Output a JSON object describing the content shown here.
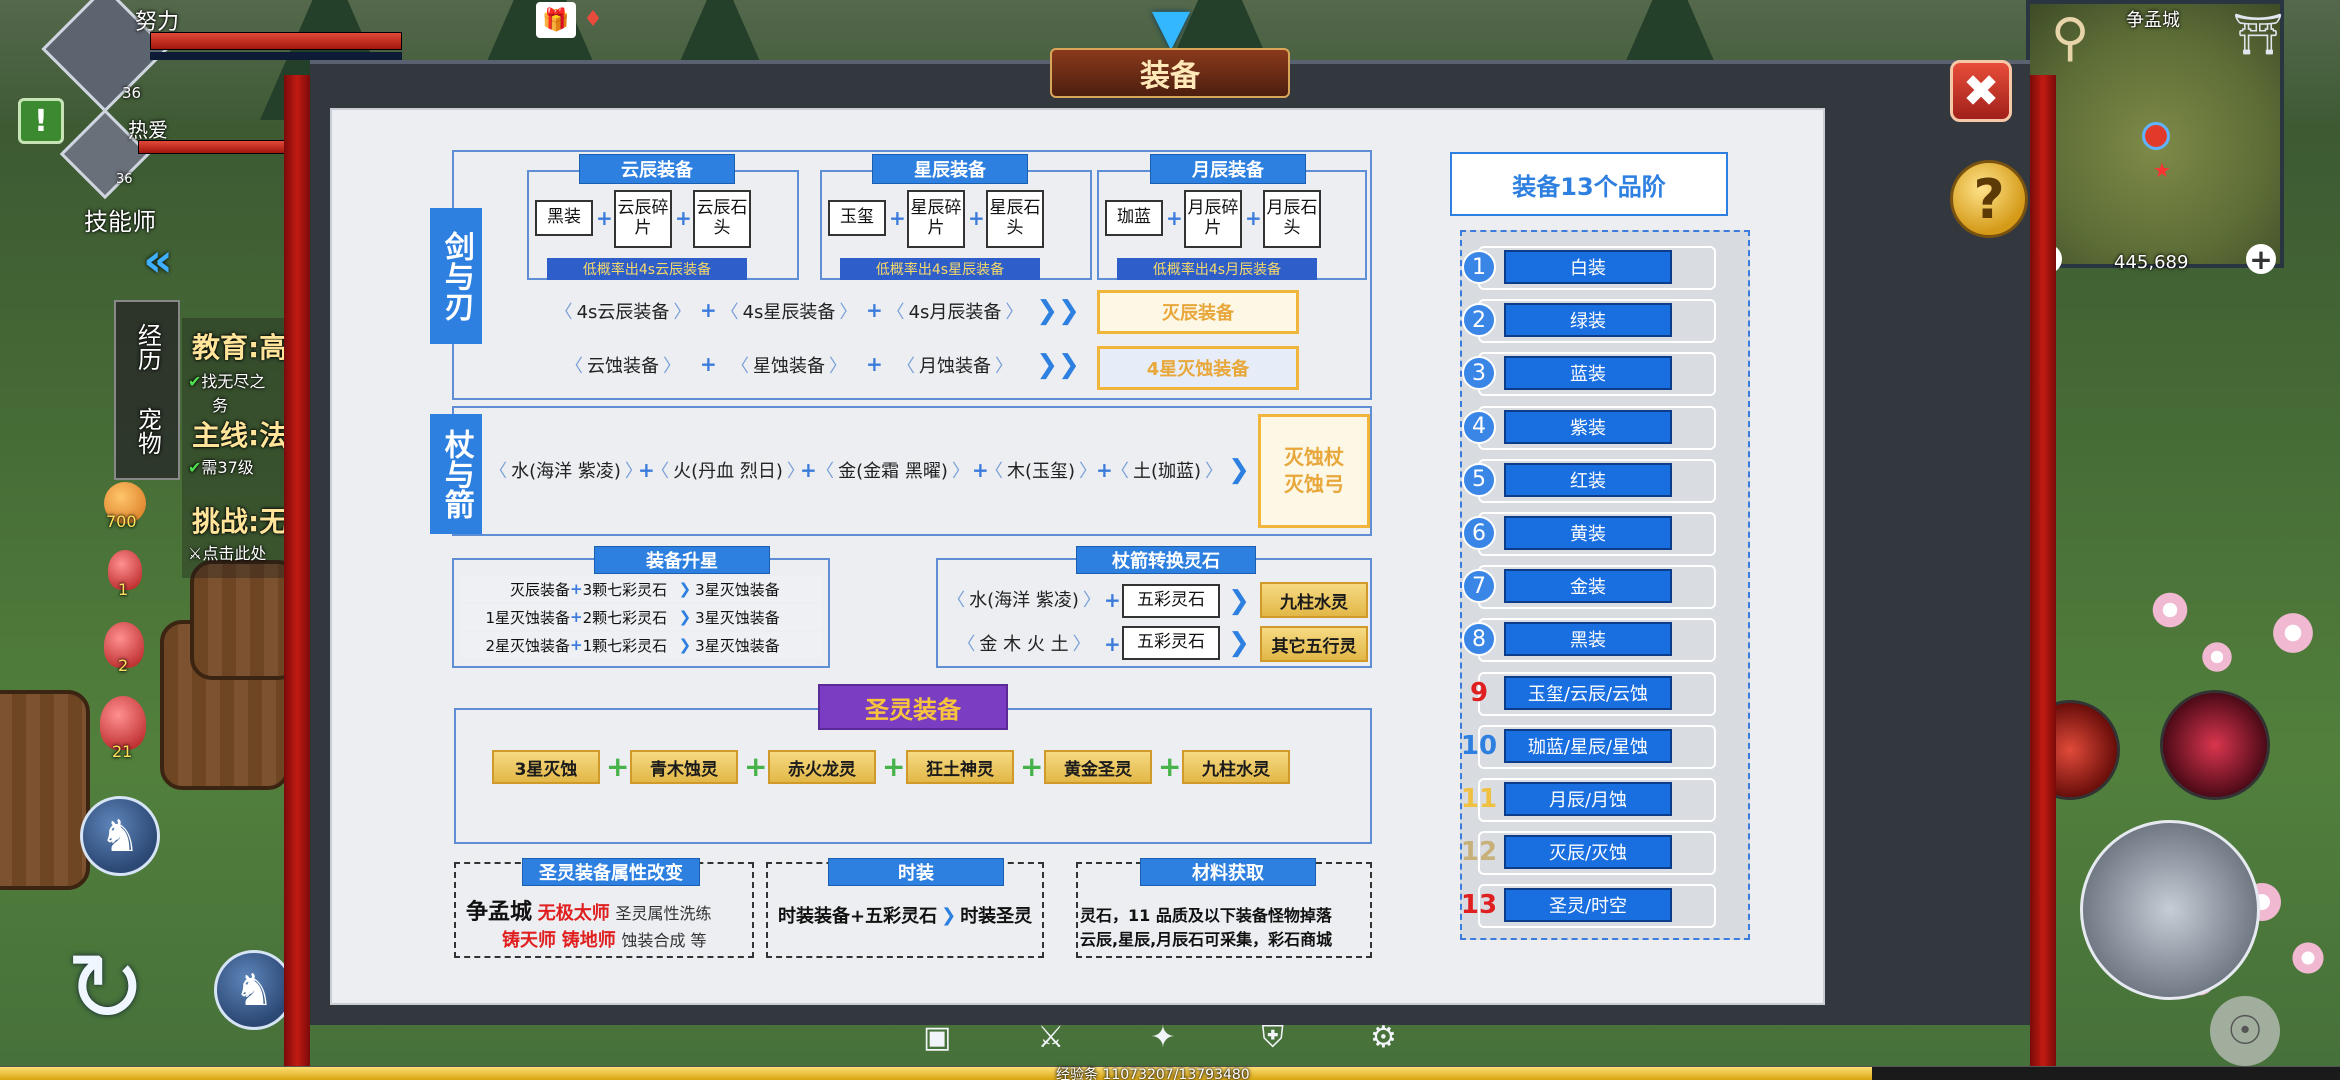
{
  "hud": {
    "player1_name": "努力",
    "player1_level": "36",
    "player2_name": "热爱",
    "player2_level": "36",
    "class_name": "技能师",
    "left_tabs": [
      "经历",
      "宠物"
    ],
    "quests": [
      {
        "title": "教育:高",
        "line": "找无尽之",
        "line2": "务"
      },
      {
        "title": "主线:法",
        "line": "需37级"
      },
      {
        "title": "挑战:无",
        "line": "点击此处"
      }
    ],
    "items": [
      {
        "count": "700"
      },
      {
        "count": "1"
      },
      {
        "count": "2"
      },
      {
        "count": "21"
      }
    ],
    "map_name": "争孟城",
    "coords": "445,689",
    "exp_label": "经验条",
    "exp_value": "11073207/13793480",
    "exp_fraction": 0.8
  },
  "panel": {
    "title": "装备",
    "close_icon": "close-icon",
    "help_label": "?"
  },
  "sword": {
    "side_label": "剑与刃",
    "groups": [
      {
        "header": "云辰装备",
        "base": "黑装",
        "mid": "云辰碎片",
        "end": "云辰石头",
        "note": "低概率出4s云辰装备"
      },
      {
        "header": "星辰装备",
        "base": "玉玺",
        "mid": "星辰碎片",
        "end": "星辰石头",
        "note": "低概率出4s星辰装备"
      },
      {
        "header": "月辰装备",
        "base": "珈蓝",
        "mid": "月辰碎片",
        "end": "月辰石头",
        "note": "低概率出4s月辰装备"
      }
    ],
    "row1": [
      "4s云辰装备",
      "4s星辰装备",
      "4s月辰装备"
    ],
    "row1_result": "灭辰装备",
    "row2": [
      "云蚀装备",
      "星蚀装备",
      "月蚀装备"
    ],
    "row2_result": "4星灭蚀装备"
  },
  "staff": {
    "side_label": "杖与箭",
    "chain": [
      "水(海洋 紫凌)",
      "火(丹血 烈日)",
      "金(金霜 黑曜)",
      "木(玉玺)",
      "土(珈蓝)"
    ],
    "result_line1": "灭蚀杖",
    "result_line2": "灭蚀弓"
  },
  "upgrade": {
    "title": "装备升星",
    "rows": [
      {
        "from": "灭辰装备",
        "stone": "3颗七彩灵石",
        "to": "3星灭蚀装备"
      },
      {
        "from": "1星灭蚀装备",
        "stone": "2颗七彩灵石",
        "to": "3星灭蚀装备"
      },
      {
        "from": "2星灭蚀装备",
        "stone": "1颗七彩灵石",
        "to": "3星灭蚀装备"
      }
    ]
  },
  "convert": {
    "title": "杖箭转换灵石",
    "rows": [
      {
        "from": "水(海洋 紫凌)",
        "stone": "五彩灵石",
        "to": "九柱水灵"
      },
      {
        "from": "金 木 火 土",
        "stone": "五彩灵石",
        "to": "其它五行灵"
      }
    ]
  },
  "holy": {
    "title": "圣灵装备",
    "items": [
      "3星灭蚀",
      "青木蚀灵",
      "赤火龙灵",
      "狂土神灵",
      "黄金圣灵",
      "九柱水灵"
    ]
  },
  "bottom": {
    "attr": {
      "title": "圣灵装备属性改变",
      "city": "争孟城",
      "npc1": "无极太师",
      "npc1_desc": "圣灵属性洗练",
      "npc2": "铸天师",
      "npc3": "铸地师",
      "npc_desc2": "蚀装合成 等"
    },
    "fashion": {
      "title": "时装",
      "left": "时装装备+五彩灵石",
      "right": "时装圣灵"
    },
    "material": {
      "title": "材料获取",
      "line1": "灵石，11 品质及以下装备怪物掉落",
      "line2": "云辰,星辰,月辰石可采集，彩石商城"
    }
  },
  "tiers": {
    "title": "装备13个品阶",
    "items": [
      {
        "num": "1",
        "label": "白装",
        "num_color": "#ffffff"
      },
      {
        "num": "2",
        "label": "绿装",
        "num_color": "#ffffff"
      },
      {
        "num": "3",
        "label": "蓝装",
        "num_color": "#ffffff"
      },
      {
        "num": "4",
        "label": "紫装",
        "num_color": "#ffffff"
      },
      {
        "num": "5",
        "label": "红装",
        "num_color": "#ffffff"
      },
      {
        "num": "6",
        "label": "黄装",
        "num_color": "#ffffff"
      },
      {
        "num": "7",
        "label": "金装",
        "num_color": "#ffffff"
      },
      {
        "num": "8",
        "label": "黑装",
        "num_color": "#ffffff"
      },
      {
        "num": "9",
        "label": "玉玺/云辰/云蚀",
        "num_color": "#e02020"
      },
      {
        "num": "10",
        "label": "珈蓝/星辰/星蚀",
        "num_color": "#2d7fe0"
      },
      {
        "num": "11",
        "label": "月辰/月蚀",
        "num_color": "#f0c040"
      },
      {
        "num": "12",
        "label": "灭辰/灭蚀",
        "num_color": "#c8b07a"
      },
      {
        "num": "13",
        "label": "圣灵/时空",
        "num_color": "#e02020"
      }
    ]
  }
}
